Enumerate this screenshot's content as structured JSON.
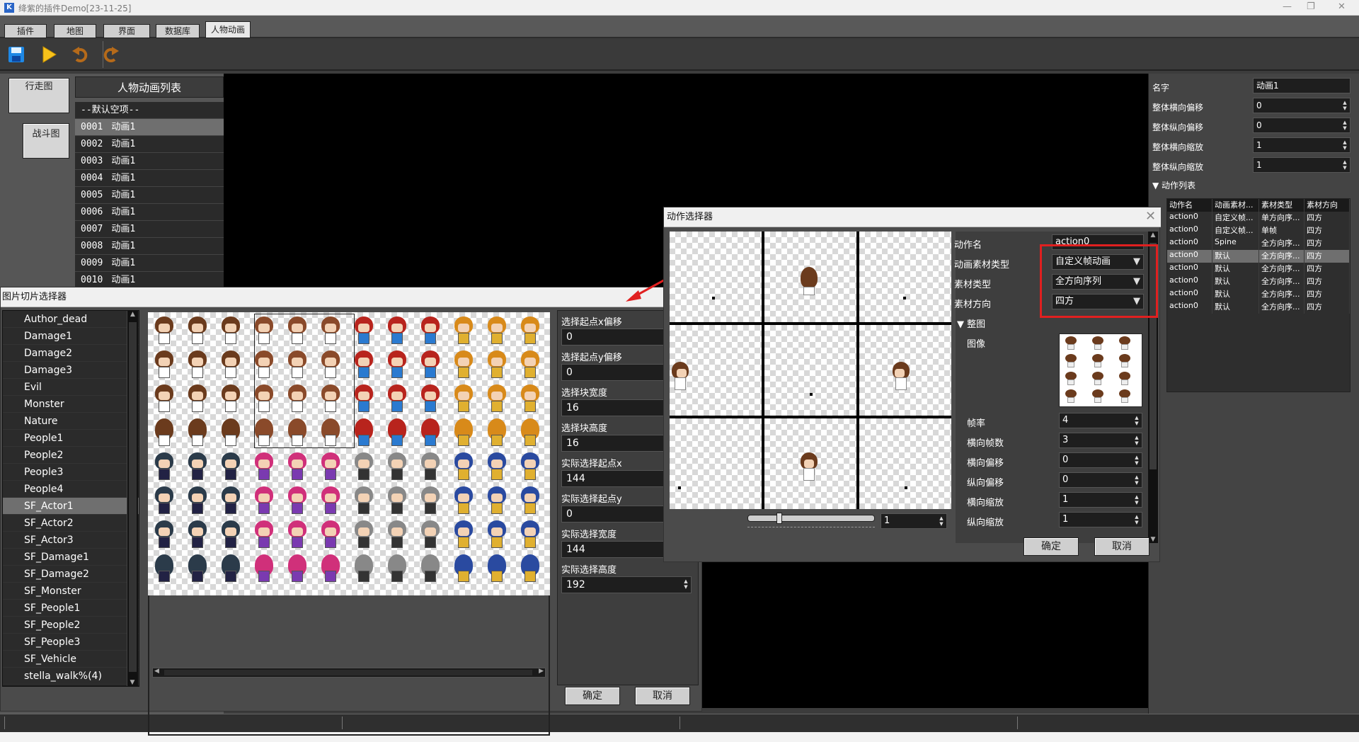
{
  "window": {
    "title": "绛紫的插件Demo[23-11-25]",
    "minimize": "—",
    "restore": "❐",
    "close": "✕"
  },
  "tabs": [
    "插件",
    "地图",
    "界面",
    "数据库",
    "人物动画"
  ],
  "active_tab": "人物动画",
  "toolbar": {
    "save": "save-icon",
    "play": "play-icon",
    "undo": "undo-icon",
    "redo": "redo-icon"
  },
  "side_buttons": {
    "walk": "行走图",
    "battle": "战斗图"
  },
  "anim_list": {
    "title": "人物动画列表",
    "default_item": "--默认空项--",
    "items": [
      {
        "id": "0001",
        "name": "动画1"
      },
      {
        "id": "0002",
        "name": "动画1"
      },
      {
        "id": "0003",
        "name": "动画1"
      },
      {
        "id": "0004",
        "name": "动画1"
      },
      {
        "id": "0005",
        "name": "动画1"
      },
      {
        "id": "0006",
        "name": "动画1"
      },
      {
        "id": "0007",
        "name": "动画1"
      },
      {
        "id": "0008",
        "name": "动画1"
      },
      {
        "id": "0009",
        "name": "动画1"
      },
      {
        "id": "0010",
        "name": "动画1"
      }
    ],
    "selected": "0001"
  },
  "right_panel": {
    "name_label": "名字",
    "name_value": "动画1",
    "offset_x_label": "整体横向偏移",
    "offset_x": "0",
    "offset_y_label": "整体纵向偏移",
    "offset_y": "0",
    "scale_x_label": "整体横向缩放",
    "scale_x": "1",
    "scale_y_label": "整体纵向缩放",
    "scale_y": "1",
    "action_list_label": "动作列表",
    "table_headers": [
      "动作名",
      "动画素材...",
      "素材类型",
      "素材方向"
    ],
    "table_rows": [
      [
        "action0",
        "自定义帧...",
        "单方向序...",
        "四方"
      ],
      [
        "action0",
        "自定义帧...",
        "单帧",
        "四方"
      ],
      [
        "action0",
        "Spine",
        "全方向序...",
        "四方"
      ],
      [
        "action0",
        "默认",
        "全方向序...",
        "四方"
      ],
      [
        "action0",
        "默认",
        "全方向序...",
        "四方"
      ],
      [
        "action0",
        "默认",
        "全方向序...",
        "四方"
      ],
      [
        "action0",
        "默认",
        "全方向序...",
        "四方"
      ],
      [
        "action0",
        "默认",
        "全方向序...",
        "四方"
      ]
    ],
    "selected_row": 3
  },
  "slice_dialog": {
    "title": "图片切片选择器",
    "files": [
      "Author_dead",
      "Damage1",
      "Damage2",
      "Damage3",
      "Evil",
      "Monster",
      "Nature",
      "People1",
      "People2",
      "People3",
      "People4",
      "SF_Actor1",
      "SF_Actor2",
      "SF_Actor3",
      "SF_Damage1",
      "SF_Damage2",
      "SF_Monster",
      "SF_People1",
      "SF_People2",
      "SF_People3",
      "SF_Vehicle",
      "stella_walk%(4)"
    ],
    "selected_file": "SF_Actor1",
    "fields": [
      {
        "label": "选择起点x偏移",
        "value": "0"
      },
      {
        "label": "选择起点y偏移",
        "value": "0"
      },
      {
        "label": "选择块宽度",
        "value": "16"
      },
      {
        "label": "选择块高度",
        "value": "16"
      },
      {
        "label": "实际选择起点x",
        "value": "144"
      },
      {
        "label": "实际选择起点y",
        "value": "0"
      },
      {
        "label": "实际选择宽度",
        "value": "144"
      },
      {
        "label": "实际选择高度",
        "value": "192"
      }
    ],
    "ok": "确定",
    "cancel": "取消"
  },
  "action_dialog": {
    "title": "动作选择器",
    "action_name_label": "动作名",
    "action_name": "action0",
    "anim_type_label": "动画素材类型",
    "anim_type": "自定义帧动画",
    "material_type_label": "素材类型",
    "material_type": "全方向序列",
    "direction_label": "素材方向",
    "direction": "四方",
    "whole_label": "整图",
    "image_label": "图像",
    "frame_rate_label": "帧率",
    "frame_rate": "4",
    "h_frames_label": "横向帧数",
    "h_frames": "3",
    "h_offset_label": "横向偏移",
    "h_offset": "0",
    "v_offset_label": "纵向偏移",
    "v_offset": "0",
    "h_scale_label": "横向缩放",
    "h_scale": "1",
    "v_scale_label": "纵向缩放",
    "v_scale": "1",
    "speed_value": "1",
    "ok": "确定",
    "cancel": "取消"
  },
  "colors": {
    "highlight": "#e02020",
    "selected_row": "#6f6f6f"
  }
}
